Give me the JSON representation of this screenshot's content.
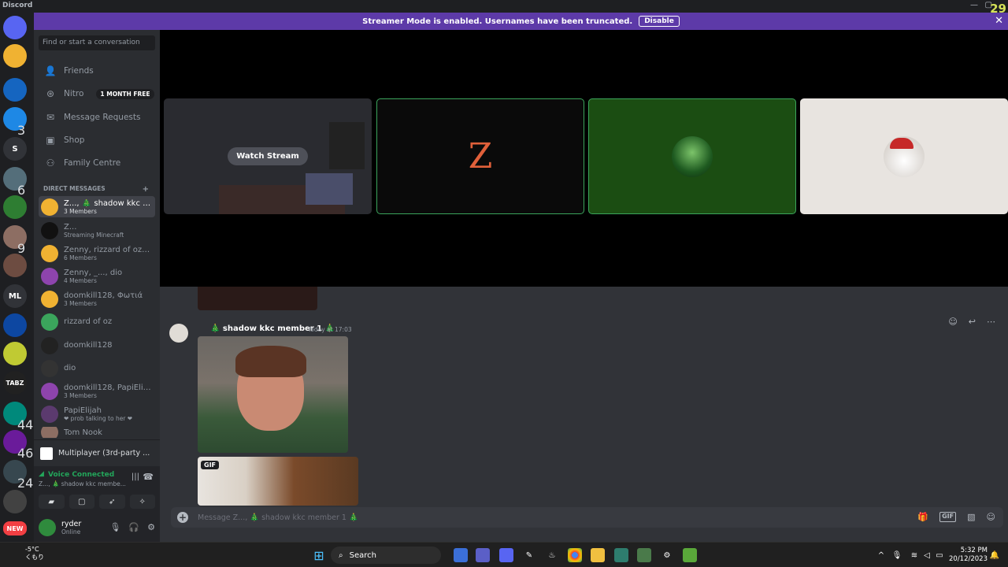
{
  "window": {
    "title": "Discord",
    "fps_overlay": "29"
  },
  "banner": {
    "text": "Streamer Mode is enabled. Usernames have been truncated.",
    "button": "Disable"
  },
  "rail": {
    "servers": [
      {
        "label": "",
        "color": "#5865f2",
        "icon": "discord-icon"
      },
      {
        "label": "",
        "color": "#f0b232",
        "icon": "friend-request-icon"
      },
      {
        "label": "",
        "color": "#1565c0",
        "icon": "server-icon"
      },
      {
        "label": "",
        "color": "#1e88e5",
        "badge": "3",
        "icon": "server-icon"
      },
      {
        "label": "S",
        "color": "#313338"
      },
      {
        "label": "",
        "color": "#546e7a",
        "badge": "6",
        "icon": "server-icon"
      },
      {
        "label": "",
        "color": "#2e7d32",
        "icon": "server-icon"
      },
      {
        "label": "",
        "color": "#8d6e63",
        "badge": "9",
        "icon": "server-icon"
      },
      {
        "label": "",
        "color": "#6d4c41",
        "icon": "server-icon"
      },
      {
        "label": "ML",
        "color": "#313338"
      },
      {
        "label": "",
        "color": "#0d47a1",
        "icon": "server-icon"
      },
      {
        "label": "",
        "color": "#c0ca33",
        "icon": "server-icon"
      },
      {
        "label": "TABZ",
        "color": "#212121"
      },
      {
        "label": "",
        "color": "#00897b",
        "badge": "44",
        "icon": "server-icon"
      },
      {
        "label": "",
        "color": "#6a1b9a",
        "badge": "46",
        "icon": "server-icon"
      },
      {
        "label": "",
        "color": "#37474f",
        "badge": "24",
        "icon": "server-icon"
      },
      {
        "label": "",
        "color": "#424242",
        "icon": "server-icon"
      },
      {
        "label": "NEW",
        "color": "#f23f43"
      }
    ]
  },
  "sidebar": {
    "search_placeholder": "Find or start a conversation",
    "nav": [
      {
        "label": "Friends",
        "icon": "friends-icon"
      },
      {
        "label": "Nitro",
        "icon": "nitro-icon",
        "promo": "1 MONTH FREE"
      },
      {
        "label": "Message Requests",
        "icon": "mail-icon"
      },
      {
        "label": "Shop",
        "icon": "shop-icon"
      },
      {
        "label": "Family Centre",
        "icon": "family-icon"
      }
    ],
    "dm_header": "DIRECT MESSAGES",
    "dms": [
      {
        "name": "Z..., 🎄 shadow kkc m...",
        "sub": "3 Members",
        "color": "#f0b232",
        "active": true
      },
      {
        "name": "Z...",
        "sub": "Streaming Minecraft",
        "color": "#111111"
      },
      {
        "name": "Zenny, rizzard of oz, d...",
        "sub": "6 Members",
        "color": "#f0b232"
      },
      {
        "name": "Zenny, _..., dio",
        "sub": "4 Members",
        "color": "#8e44ad"
      },
      {
        "name": "doomkill128, Φωτιά",
        "sub": "3 Members",
        "color": "#f0b232"
      },
      {
        "name": "rizzard of oz",
        "sub": "",
        "color": "#3ba55c"
      },
      {
        "name": "doomkill128",
        "sub": "",
        "color": "#222222"
      },
      {
        "name": "dio",
        "sub": "",
        "color": "#333333"
      },
      {
        "name": "doomkill128, PapiElijah",
        "sub": "3 Members",
        "color": "#8e44ad"
      },
      {
        "name": "PapiElijah",
        "sub": "❤ prob talking to her ❤",
        "color": "#5b3a6e"
      },
      {
        "name": "Tom Nook",
        "sub": "",
        "color": "#8d6e63"
      }
    ],
    "activity": {
      "label": "Multiplayer (3rd-party ..."
    },
    "voice": {
      "status": "Voice Connected",
      "channel": "Z..., 🎄 shadow kkc membe..."
    },
    "user": {
      "name": "ryder",
      "status": "Online"
    }
  },
  "call": {
    "watch_label": "Watch Stream",
    "tiles": [
      {
        "kind": "stream",
        "bg": "#2a2b30",
        "border": "#2a2b30"
      },
      {
        "kind": "avatar",
        "bg": "#0a0a0a",
        "border": "#3ba55c",
        "glyph": "Z"
      },
      {
        "kind": "avatar",
        "bg": "#1b4d12",
        "border": "#3ba55c"
      },
      {
        "kind": "avatar",
        "bg": "#e8e4e0",
        "border": "#e8e4e0"
      }
    ]
  },
  "chat": {
    "author": "🎄 shadow kkc member 1 🎄",
    "timestamp": "Today at 17:03",
    "gif_badge": "GIF",
    "composer_placeholder": "Message Z..., 🎄 shadow kkc member 1 🎄"
  },
  "taskbar": {
    "weather_temp": "-5°C",
    "weather_desc": "くもり",
    "search_label": "Search",
    "time": "5:32 PM",
    "date": "20/12/2023"
  }
}
